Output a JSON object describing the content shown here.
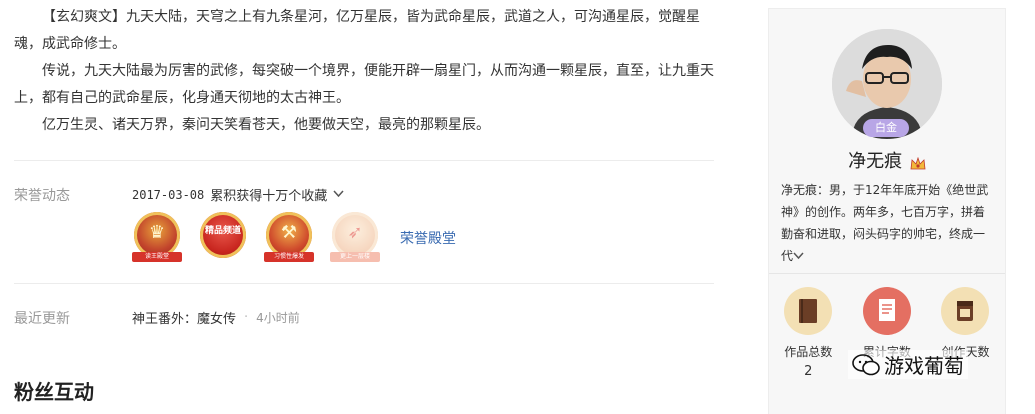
{
  "intro": {
    "para1_tag": "【玄幻爽文】",
    "para1_text": "九天大陆，天穹之上有九条星河，亿万星辰，皆为武命星辰，武道之人，可沟通星辰，觉醒星魂，成武命修士。",
    "para2": "传说，九天大陆最为厉害的武修，每突破一个境界，便能开辟一扇星门，从而沟通一颗星辰，直至，让九重天上，都有自己的武命星辰，化身通天彻地的太古神王。",
    "para3": "亿万生灵、诸天万界，秦问天笑看苍天，他要做天空，最亮的那颗星辰。"
  },
  "honor": {
    "label": "荣誉动态",
    "date": "2017-03-08",
    "text": "累积获得十万个收藏",
    "badges": [
      {
        "icon": "crown-icon",
        "text": "读王殿堂",
        "glyph": "♛"
      },
      {
        "icon": "boutique-channel-icon",
        "text": "精品频道",
        "glyph": ""
      },
      {
        "icon": "hammer-icon",
        "text": "习惯性爆发",
        "glyph": "⚒"
      },
      {
        "icon": "rocket-icon",
        "text": "更上一层楼",
        "glyph": "➶"
      }
    ],
    "hall_link": "荣誉殿堂"
  },
  "update": {
    "label": "最近更新",
    "chapter": "神王番外：魔女传",
    "time": "4小时前"
  },
  "fans": {
    "title": "粉丝互动"
  },
  "author": {
    "level": "白金",
    "name": "净无痕",
    "bio": "净无痕：男，于12年年底开始《绝世武神》的创作。两年多，七百万字，拼着勤奋和进取，闷头码字的帅宅，终成一代"
  },
  "stats": [
    {
      "label": "作品总数",
      "value": "2",
      "icon": "book-icon"
    },
    {
      "label": "累计字数",
      "value": "",
      "icon": "document-icon"
    },
    {
      "label": "创作天数",
      "value": "",
      "icon": "calendar-icon"
    }
  ],
  "watermark": "游戏葡萄",
  "colors": {
    "link": "#3a6bb1",
    "muted": "#999999",
    "level_tag": "#b8a6e6"
  }
}
